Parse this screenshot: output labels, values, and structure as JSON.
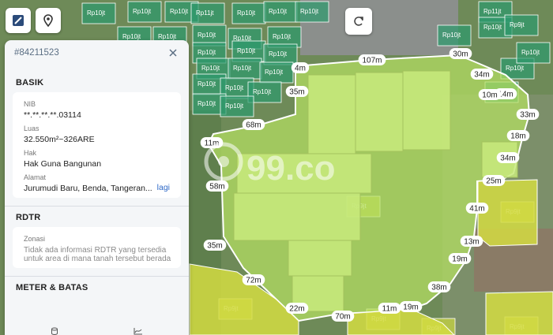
{
  "map": {
    "parcel_price_labels": [
      "Rp10jt",
      "Rp10jt",
      "Rp10jt",
      "Rp11jt",
      "Rp10jt",
      "Rp10jt",
      "Rp10jt",
      "Rp10jt",
      "Rp10jt",
      "Rp10jt",
      "Rp10jt",
      "Rp10jt",
      "Rp10jt",
      "Rp10jt",
      "Rp10jt",
      "Rp10jt",
      "Rp10jt",
      "Rp10jt",
      "Rp10jt",
      "Rp10jt",
      "Rp10jt",
      "Rp10jt",
      "Rp10jt",
      "Rp11jt",
      "Rp10jt",
      "Rp10jt",
      "Rp10jt",
      "Rp9jt",
      "Rp9jt",
      "Rp9jt",
      "Rp9jt",
      "Rp9jt",
      "Rp9jt",
      "Rp9jt",
      "Rp10jt",
      "Rp10jt"
    ],
    "measurements": [
      "107m",
      "30m",
      "34m",
      "14m",
      "33m",
      "18m",
      "34m",
      "25m",
      "41m",
      "13m",
      "19m",
      "38m",
      "19m",
      "11m",
      "70m",
      "22m",
      "72m",
      "35m",
      "58m",
      "11m",
      "68m",
      "35m",
      "4m",
      "10m"
    ],
    "watermark": "99.co",
    "colors": {
      "parcel_green": "#2e9a6d",
      "parcel_yellow": "#c9d640",
      "selected_fill": "#b9e36a",
      "boundary": "#ffffff"
    }
  },
  "controls": {
    "layers_icon": "layers-icon",
    "location_icon": "map-pin-icon",
    "refresh_icon": "refresh-icon"
  },
  "panel": {
    "id": "#84211523",
    "basik": {
      "title": "BASIK",
      "nib_label": "NIB",
      "nib_value": "**.**.**.**.03114",
      "luas_label": "Luas",
      "luas_value": "32.550m²~326ARE",
      "hak_label": "Hak",
      "hak_value": "Hak Guna Bangunan",
      "alamat_label": "Alamat",
      "alamat_value": "Jurumudi Baru, Benda, Tangeran...",
      "lagi": "lagi"
    },
    "rdtr": {
      "title": "RDTR",
      "zonasi_label": "Zonasi",
      "zonasi_text": "Tidak ada informasi RDTR yang tersedia untuk area di mana tanah tersebut berada"
    },
    "meter_batas_title": "METER & BATAS"
  }
}
